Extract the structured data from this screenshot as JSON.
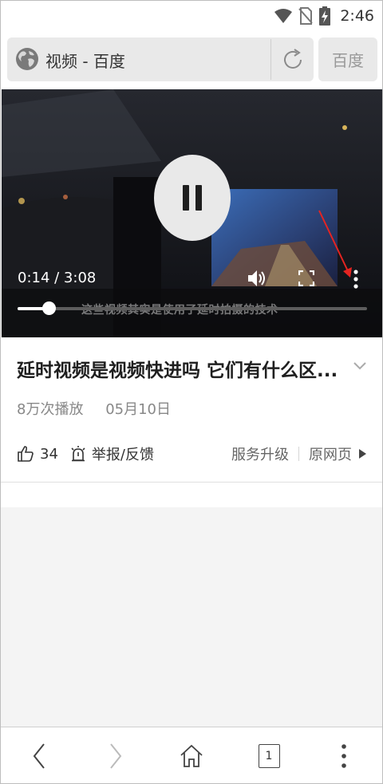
{
  "status_bar": {
    "time": "2:46",
    "icons": [
      "wifi-icon",
      "no-sim-icon",
      "battery-charging-icon"
    ]
  },
  "address_bar": {
    "page_title": "视频 - 百度",
    "search_button_label": "百度",
    "icons": [
      "globe-icon",
      "refresh-icon"
    ]
  },
  "video": {
    "current_time": "0:14",
    "duration": "3:08",
    "time_display": "0:14 / 3:08",
    "progress_fraction": 0.09,
    "state": "playing",
    "subtitle": "这些视频其实是使用了延时拍摄的技术",
    "controls": [
      "pause-icon",
      "volume-icon",
      "fullscreen-icon",
      "more-vertical-icon"
    ],
    "annotation_color": "#e52421"
  },
  "article": {
    "title": "延时视频是视频快进吗 它们有什么区...",
    "views": "8万次播放",
    "date": "05月10日"
  },
  "actions": {
    "like_count": "34",
    "report_label": "举报/反馈",
    "upgrade_label": "服务升级",
    "original_label": "原网页"
  },
  "bottom_nav": {
    "tab_count": "1",
    "icons": [
      "back-icon",
      "forward-icon",
      "home-icon",
      "tabs-icon",
      "menu-icon"
    ]
  },
  "colors": {
    "address_bg": "#e9e9e9",
    "video_bg": "#121317",
    "gray_area": "#f4f4f4"
  }
}
